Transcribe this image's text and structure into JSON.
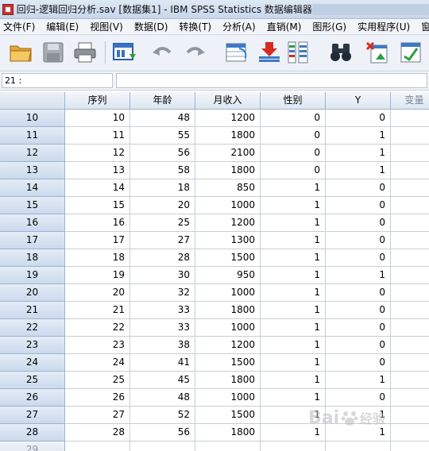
{
  "window": {
    "title": "回归-逻辑回归分析.sav [数据集1] - IBM SPSS Statistics 数据编辑器"
  },
  "menu": [
    "文件(F)",
    "编辑(E)",
    "视图(V)",
    "数据(D)",
    "转换(T)",
    "分析(A)",
    "直销(M)",
    "图形(G)",
    "实用程序(U)",
    "窗"
  ],
  "toolbar": {
    "icons": [
      "open-folder-icon",
      "save-disk-icon",
      "print-icon",
      "dialog-recall-icon",
      "undo-icon",
      "redo-icon",
      "go-to-case-icon",
      "insert-cases-icon",
      "variables-icon",
      "find-icon",
      "insert-variable-icon",
      "split-file-icon"
    ]
  },
  "refbar": {
    "cell_ref": "21 :",
    "cell_value": ""
  },
  "grid": {
    "columns": [
      "序列",
      "年龄",
      "月收入",
      "性别",
      "Y",
      "变量"
    ],
    "rows": [
      {
        "n": "10",
        "cells": [
          "10",
          "48",
          "1200",
          "0",
          "0"
        ]
      },
      {
        "n": "11",
        "cells": [
          "11",
          "55",
          "1800",
          "0",
          "1"
        ]
      },
      {
        "n": "12",
        "cells": [
          "12",
          "56",
          "2100",
          "0",
          "1"
        ]
      },
      {
        "n": "13",
        "cells": [
          "13",
          "58",
          "1800",
          "0",
          "1"
        ]
      },
      {
        "n": "14",
        "cells": [
          "14",
          "18",
          "850",
          "1",
          "0"
        ]
      },
      {
        "n": "15",
        "cells": [
          "15",
          "20",
          "1000",
          "1",
          "0"
        ]
      },
      {
        "n": "16",
        "cells": [
          "16",
          "25",
          "1200",
          "1",
          "0"
        ]
      },
      {
        "n": "17",
        "cells": [
          "17",
          "27",
          "1300",
          "1",
          "0"
        ]
      },
      {
        "n": "18",
        "cells": [
          "18",
          "28",
          "1500",
          "1",
          "0"
        ]
      },
      {
        "n": "19",
        "cells": [
          "19",
          "30",
          "950",
          "1",
          "1"
        ]
      },
      {
        "n": "20",
        "cells": [
          "20",
          "32",
          "1000",
          "1",
          "0"
        ]
      },
      {
        "n": "21",
        "cells": [
          "21",
          "33",
          "1800",
          "1",
          "0"
        ]
      },
      {
        "n": "22",
        "cells": [
          "22",
          "33",
          "1000",
          "1",
          "0"
        ]
      },
      {
        "n": "23",
        "cells": [
          "23",
          "38",
          "1200",
          "1",
          "0"
        ]
      },
      {
        "n": "24",
        "cells": [
          "24",
          "41",
          "1500",
          "1",
          "0"
        ]
      },
      {
        "n": "25",
        "cells": [
          "25",
          "45",
          "1800",
          "1",
          "1"
        ]
      },
      {
        "n": "26",
        "cells": [
          "26",
          "48",
          "1000",
          "1",
          "0"
        ]
      },
      {
        "n": "27",
        "cells": [
          "27",
          "52",
          "1500",
          "1",
          "1"
        ]
      },
      {
        "n": "28",
        "cells": [
          "28",
          "56",
          "1800",
          "1",
          "1"
        ]
      },
      {
        "n": "29",
        "cells": [
          "",
          "",
          "",
          "",
          ""
        ]
      }
    ]
  },
  "watermark": {
    "left": "Bai",
    "right": "经验"
  }
}
